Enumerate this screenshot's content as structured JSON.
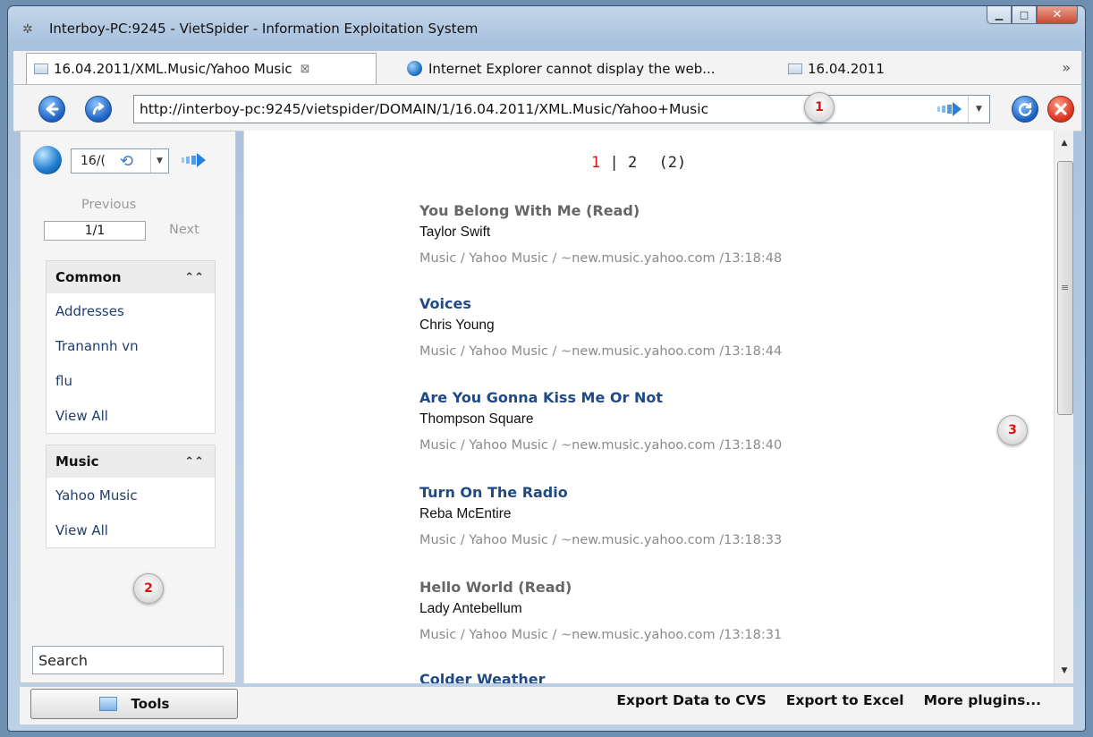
{
  "window": {
    "title": "Interboy-PC:9245 - VietSpider - Information Exploitation System"
  },
  "tabs": [
    {
      "label": "16.04.2011/XML.Music/Yahoo Music",
      "close": "⊠"
    },
    {
      "label": "Internet Explorer cannot display the web..."
    },
    {
      "label": "16.04.2011"
    }
  ],
  "tabs_overflow": "»",
  "navbar": {
    "url": "http://interboy-pc:9245/vietspider/DOMAIN/1/16.04.2011/XML.Music/Yahoo+Music"
  },
  "markers": [
    "1",
    "2",
    "3"
  ],
  "sidebar": {
    "date_value": "16/(",
    "previous_label": "Previous",
    "page_value": "1/1",
    "next_label": "Next",
    "panels": [
      {
        "title": "Common",
        "items": [
          "Addresses",
          "Tranannh vn",
          "flu",
          "View All"
        ]
      },
      {
        "title": "Music",
        "items": [
          "Yahoo Music",
          "View All"
        ]
      }
    ],
    "search_placeholder": "Search"
  },
  "pager": {
    "current": "1",
    "sep": "|",
    "other": "2",
    "total": "(2)"
  },
  "items": [
    {
      "title": "You Belong With Me",
      "read": "(Read)",
      "artist": "Taylor Swift",
      "meta": "Music / Yahoo Music / ~new.music.yahoo.com /13:18:48"
    },
    {
      "title": "Voices",
      "read": "",
      "artist": "Chris Young",
      "meta": "Music / Yahoo Music / ~new.music.yahoo.com /13:18:44"
    },
    {
      "title": "Are You Gonna Kiss Me Or Not",
      "read": "",
      "artist": "Thompson Square",
      "meta": "Music / Yahoo Music / ~new.music.yahoo.com /13:18:40"
    },
    {
      "title": "Turn On The Radio",
      "read": "",
      "artist": "Reba McEntire",
      "meta": "Music / Yahoo Music / ~new.music.yahoo.com /13:18:33"
    },
    {
      "title": "Hello World",
      "read": "(Read)",
      "artist": "Lady Antebellum",
      "meta": "Music / Yahoo Music / ~new.music.yahoo.com /13:18:31"
    },
    {
      "title": "Colder Weather",
      "read": "",
      "artist": "",
      "meta": ""
    }
  ],
  "bottom": {
    "tools_label": "Tools",
    "actions": [
      "Export Data to CVS",
      "Export to Excel",
      "More plugins..."
    ]
  }
}
